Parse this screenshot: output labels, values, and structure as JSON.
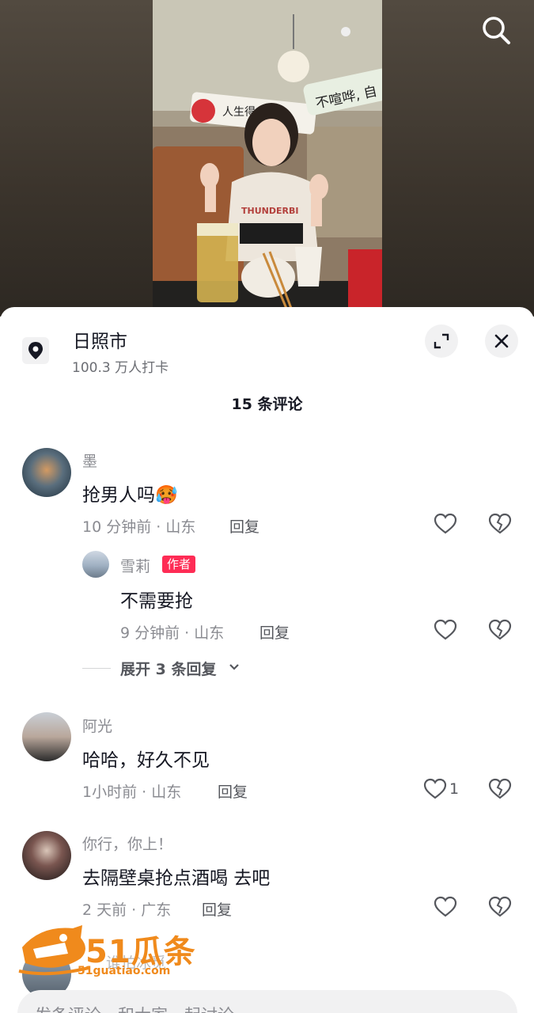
{
  "header": {
    "search_icon": "search-icon"
  },
  "location": {
    "name": "日照市",
    "checkins": "100.3 万人打卡",
    "pin_icon": "location-pin-icon",
    "expand_icon": "expand-icon",
    "close_icon": "close-icon"
  },
  "comments_title": "15 条评论",
  "comments": [
    {
      "user": "墨",
      "text": "抢男人吗🥵",
      "meta": "10 分钟前 · 山东",
      "reply": "回复"
    },
    {
      "user": "阿光",
      "text": "哈哈，好久不见",
      "meta": "1小时前 · 山东",
      "reply": "回复",
      "likes": "1"
    },
    {
      "user": "你行，你上！",
      "text": "去隔壁桌抢点酒喝  去吧",
      "meta": "2 天前 · 广东",
      "reply": "回复"
    },
    {
      "user": "谁怕冰觅"
    }
  ],
  "sub_reply": {
    "user": "雪莉",
    "badge": "作者",
    "text": "不需要抢",
    "meta": "9 分钟前 · 山东",
    "reply": "回复"
  },
  "expand_replies": "展开 3 条回复",
  "input_placeholder": "发条评论，和大家一起讨论",
  "watermark": {
    "brand": "51瓜条",
    "url": "51guatiao.com"
  },
  "photo_signs": {
    "left": "人生得",
    "right": "不喧哗, 自",
    "shirt": "THUNDERBI"
  },
  "colors": {
    "accent": "#fe2c55",
    "text": "#161823",
    "muted": "#8a8b91"
  }
}
